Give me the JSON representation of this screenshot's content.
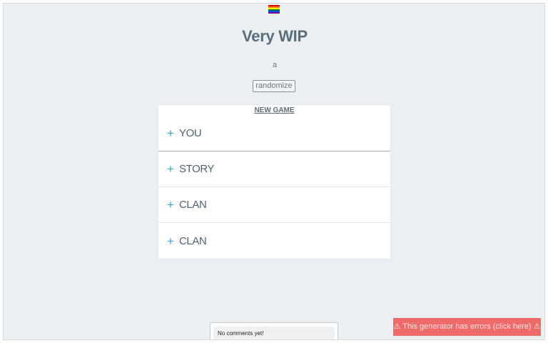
{
  "header": {
    "flag_icon": "rainbow-flag-icon",
    "flag_colors": [
      "#e40303",
      "#ff8c00",
      "#ffed00",
      "#008026",
      "#004dff",
      "#750787"
    ],
    "title": "Very WIP",
    "subtitle": "a",
    "randomize_label": "randomize"
  },
  "panel": {
    "heading": "NEW GAME",
    "items": [
      {
        "icon": "+",
        "label": "YOU"
      },
      {
        "icon": "+",
        "label": "STORY"
      },
      {
        "icon": "+",
        "label": "CLAN"
      },
      {
        "icon": "+",
        "label": "CLAN"
      }
    ]
  },
  "comments": {
    "text": "No comments yet!"
  },
  "error_banner": {
    "text": "⚠ This generator has errors (click here) ⚠"
  },
  "colors": {
    "accent": "#36a6d6",
    "error": "#f16a6a",
    "background": "#eceff2"
  }
}
